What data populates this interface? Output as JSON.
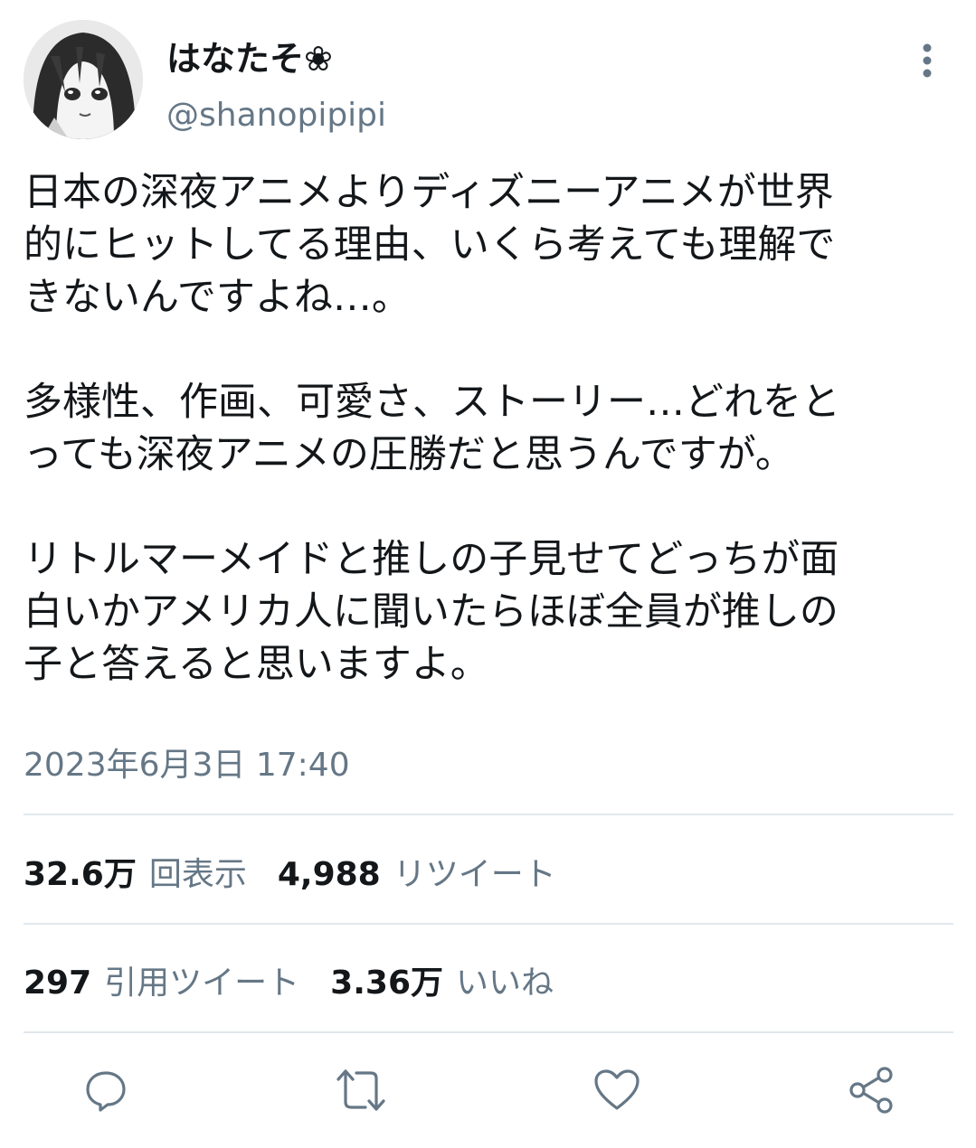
{
  "tweet": {
    "author": {
      "display_name": "はなたそ❀",
      "handle": "@shanopipipi"
    },
    "paragraphs": [
      "日本の深夜アニメよりディズニーアニメが世界\n的にヒットしてる理由、いくら考えても理解で\nきないんですよね…。",
      "多様性、作画、可愛さ、ストーリー…どれをと\nっても深夜アニメの圧勝だと思うんですが。",
      "リトルマーメイドと推しの子見せてどっちが面\n白いかアメリカ人に聞いたらほぼ全員が推しの\n子と答えると思いますよ。"
    ],
    "timestamp": "2023年6月3日 17:40"
  },
  "stats": {
    "views": {
      "count": "32.6万",
      "label": "回表示"
    },
    "retweets": {
      "count": "4,988",
      "label": "リツイート"
    },
    "quotes": {
      "count": "297",
      "label": "引用ツイート"
    },
    "likes": {
      "count": "3.36万",
      "label": "いいね"
    }
  },
  "actions": {
    "reply_icon": "reply-icon",
    "retweet_icon": "retweet-icon",
    "like_icon": "heart-icon",
    "share_icon": "share-icon"
  },
  "colors": {
    "text": "#14171a",
    "secondary": "#657786",
    "divider": "#e1e8ed"
  }
}
